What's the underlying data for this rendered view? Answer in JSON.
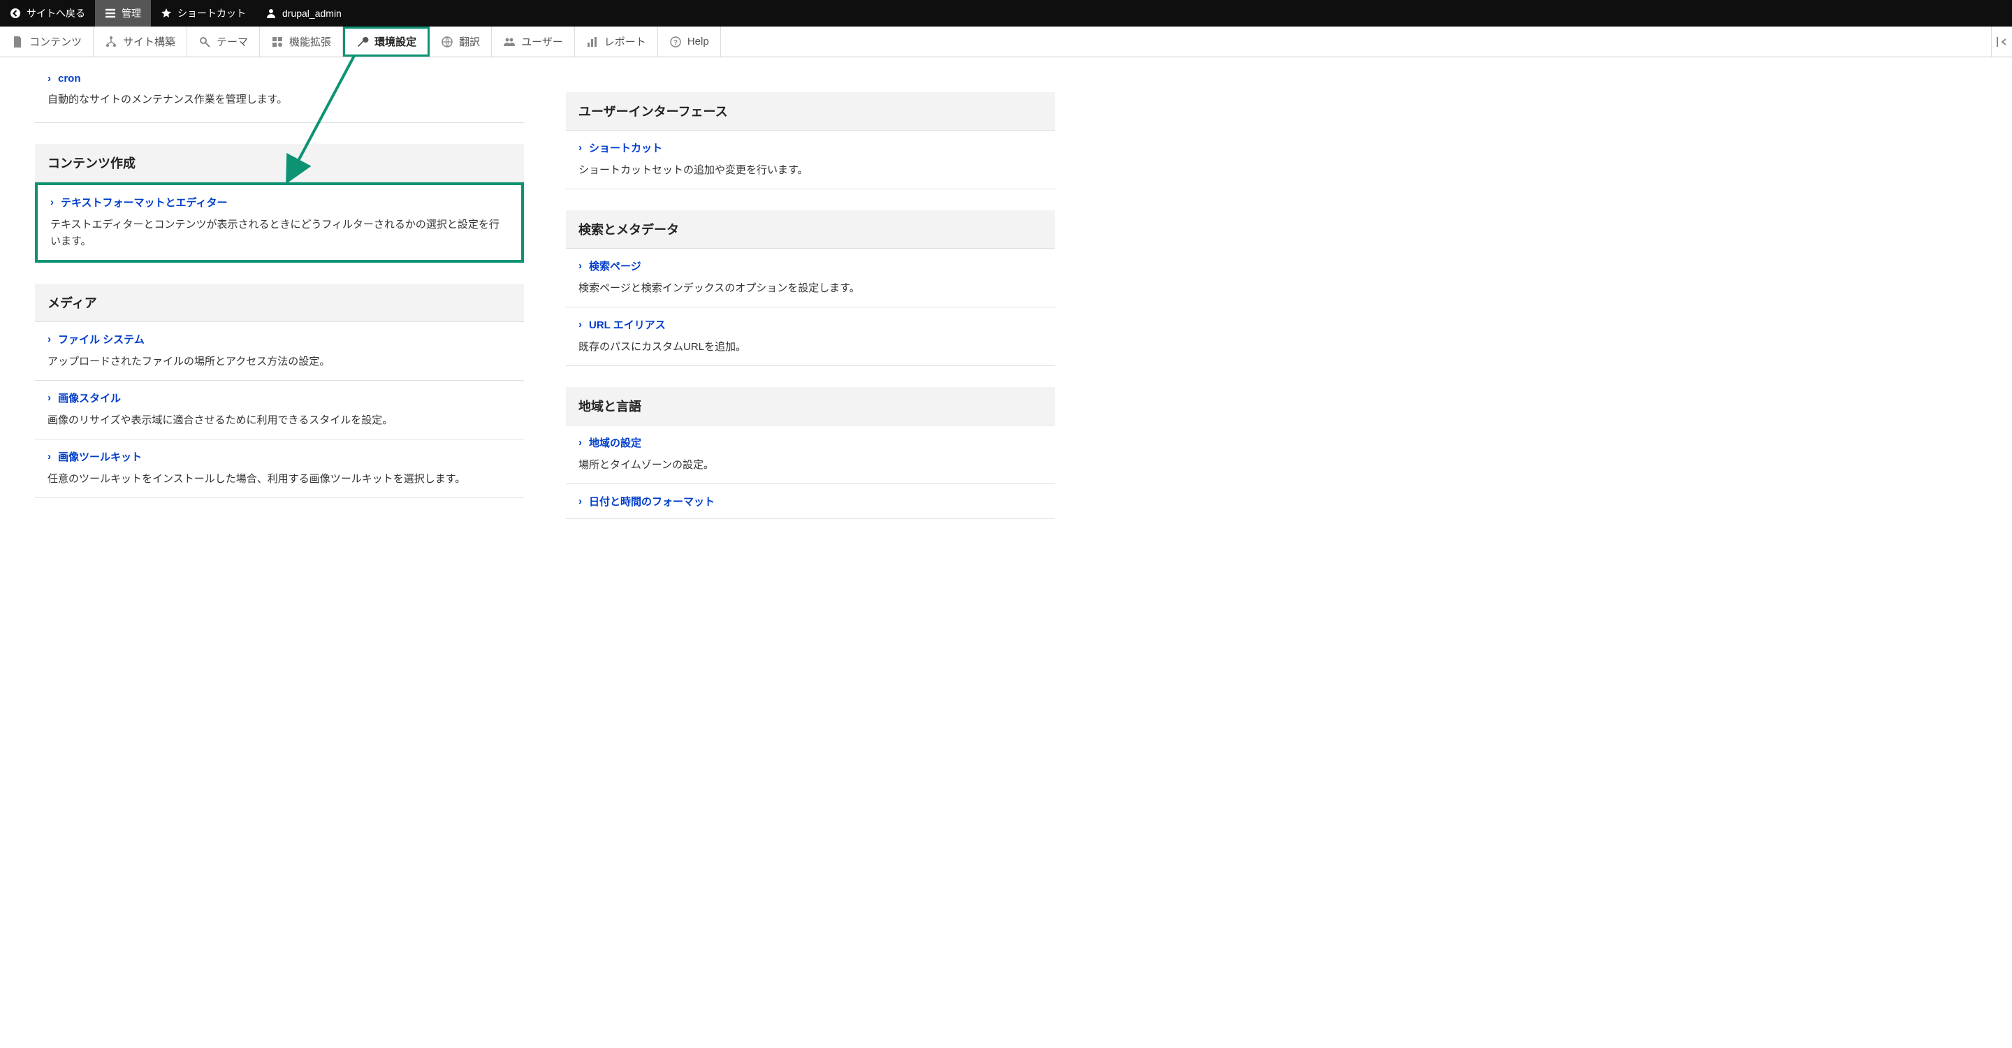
{
  "topbar": {
    "back": "サイトへ戻る",
    "manage": "管理",
    "shortcuts": "ショートカット",
    "user": "drupal_admin"
  },
  "adminbar": {
    "content": "コンテンツ",
    "structure": "サイト構築",
    "appearance": "テーマ",
    "extend": "機能拡張",
    "config": "環境設定",
    "translate": "翻訳",
    "people": "ユーザー",
    "reports": "レポート",
    "help": "Help"
  },
  "left": {
    "cron": {
      "title": "cron",
      "desc": "自動的なサイトのメンテナンス作業を管理します。"
    },
    "authoring": {
      "header": "コンテンツ作成",
      "formats": {
        "title": "テキストフォーマットとエディター",
        "desc": "テキストエディターとコンテンツが表示されるときにどうフィルターされるかの選択と設定を行います。"
      }
    },
    "media": {
      "header": "メディア",
      "filesystem": {
        "title": "ファイル システム",
        "desc": "アップロードされたファイルの場所とアクセス方法の設定。"
      },
      "imagestyles": {
        "title": "画像スタイル",
        "desc": "画像のリサイズや表示域に適合させるために利用できるスタイルを設定。"
      },
      "toolkit": {
        "title": "画像ツールキット",
        "desc": "任意のツールキットをインストールした場合、利用する画像ツールキットを選択します。"
      }
    }
  },
  "right": {
    "ui": {
      "header": "ユーザーインターフェース",
      "shortcuts": {
        "title": "ショートカット",
        "desc": "ショートカットセットの追加や変更を行います。"
      }
    },
    "search": {
      "header": "検索とメタデータ",
      "pages": {
        "title": "検索ページ",
        "desc": "検索ページと検索インデックスのオプションを設定します。"
      },
      "alias": {
        "title": "URL エイリアス",
        "desc": "既存のパスにカスタムURLを追加。"
      }
    },
    "regional": {
      "header": "地域と言語",
      "settings": {
        "title": "地域の設定",
        "desc": "場所とタイムゾーンの設定。"
      },
      "datetime": {
        "title": "日付と時間のフォーマット"
      }
    }
  }
}
